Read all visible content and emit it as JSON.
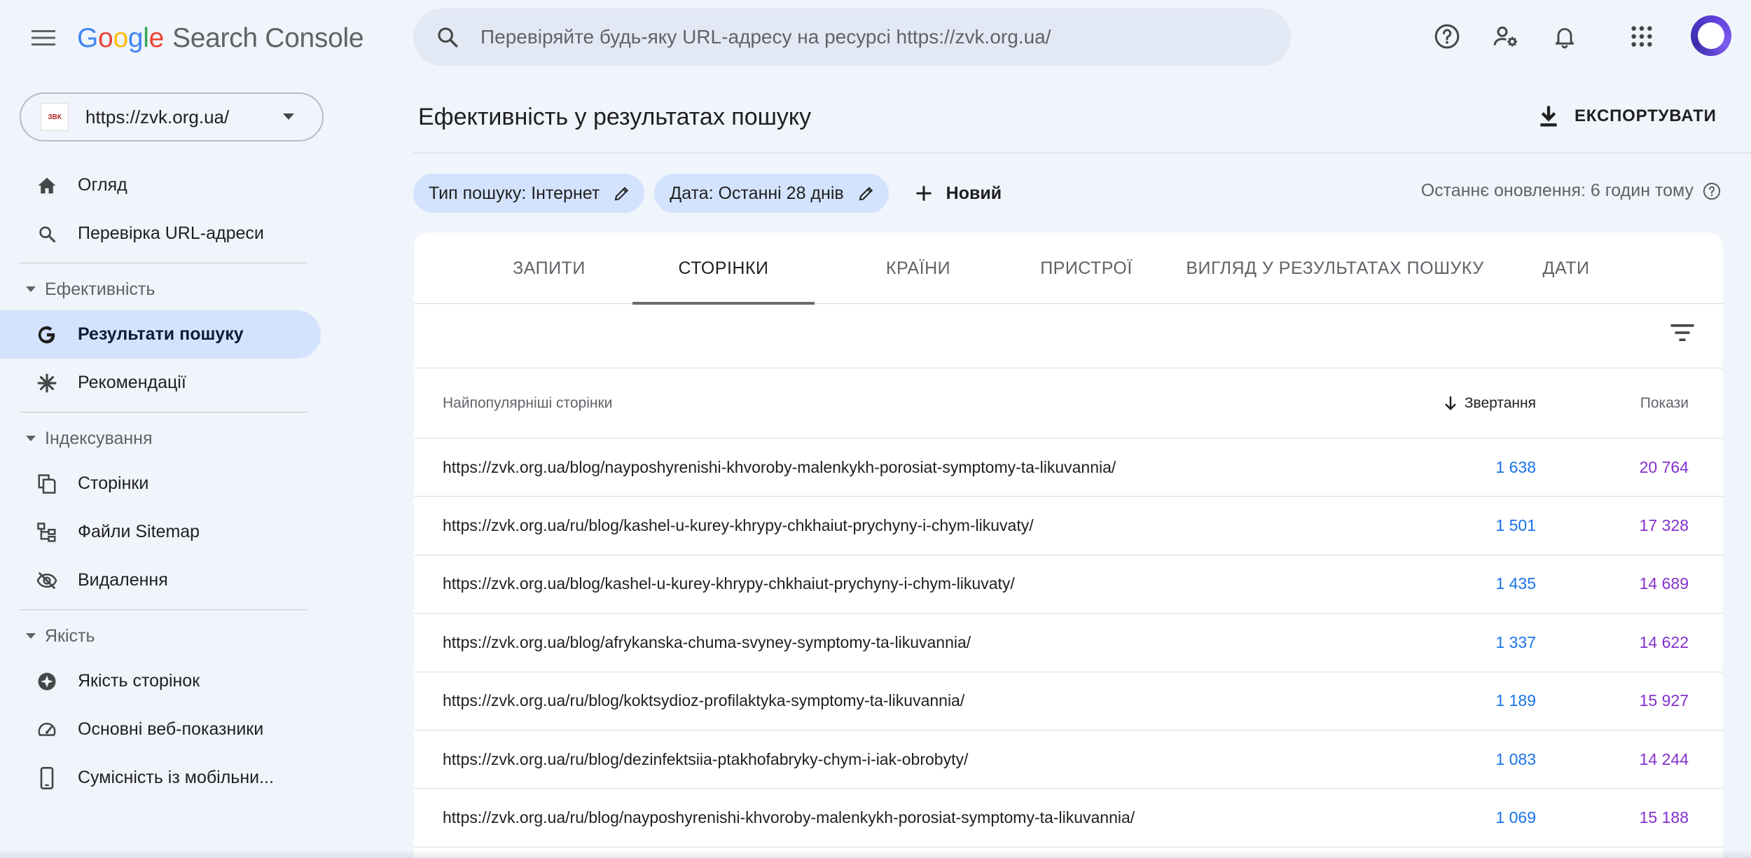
{
  "app": {
    "logo_letters": [
      "G",
      "o",
      "o",
      "g",
      "l",
      "e"
    ],
    "product": "Search Console"
  },
  "search": {
    "placeholder": "Перевіряйте будь-яку URL-адресу на ресурсі https://zvk.org.ua/"
  },
  "top_actions": [
    "help-icon",
    "manage-users-icon",
    "notifications-icon",
    "apps-grid-icon"
  ],
  "property": {
    "favicon_text": "ЗВК",
    "url": "https://zvk.org.ua/"
  },
  "sidebar": {
    "overview": "Огляд",
    "url_inspection": "Перевірка URL-адреси",
    "performance_section": "Ефективність",
    "search_results": "Результати пошуку",
    "recommendations": "Рекомендації",
    "indexing_section": "Індексування",
    "pages": "Сторінки",
    "sitemaps": "Файли Sitemap",
    "removals": "Видалення",
    "quality_section": "Якість",
    "page_experience": "Якість сторінок",
    "core_web_vitals": "Основні веб-показники",
    "mobile_usability": "Сумісність із мобільни..."
  },
  "main": {
    "title": "Ефективність у результатах пошуку",
    "export_label": "ЕКСПОРТУВАТИ",
    "chip_search_type": "Тип пошуку: Інтернет",
    "chip_date": "Дата: Останні 28 днів",
    "new_label": "Новий",
    "last_update": "Останнє оновлення: 6 годин тому"
  },
  "tabs": {
    "queries": "ЗАПИТИ",
    "pages": "СТОРІНКИ",
    "countries": "КРАЇНИ",
    "devices": "ПРИСТРОЇ",
    "search_appearance": "ВИГЛЯД У РЕЗУЛЬТАТАХ ПОШУКУ",
    "dates": "ДАТИ",
    "active": "pages"
  },
  "table": {
    "col_page": "Найпопулярніші сторінки",
    "col_clicks": "Звертання",
    "col_impressions": "Покази",
    "rows": [
      {
        "url": "https://zvk.org.ua/blog/nayposhyrenishi-khvoroby-malenkykh-porosiat-symptomy-ta-likuvannia/",
        "clicks": "1 638",
        "impressions": "20 764"
      },
      {
        "url": "https://zvk.org.ua/ru/blog/kashel-u-kurey-khrypy-chkhaiut-prychyny-i-chym-likuvaty/",
        "clicks": "1 501",
        "impressions": "17 328"
      },
      {
        "url": "https://zvk.org.ua/blog/kashel-u-kurey-khrypy-chkhaiut-prychyny-i-chym-likuvaty/",
        "clicks": "1 435",
        "impressions": "14 689"
      },
      {
        "url": "https://zvk.org.ua/blog/afrykanska-chuma-svyney-symptomy-ta-likuvannia/",
        "clicks": "1 337",
        "impressions": "14 622"
      },
      {
        "url": "https://zvk.org.ua/ru/blog/koktsydioz-profilaktyka-symptomy-ta-likuvannia/",
        "clicks": "1 189",
        "impressions": "15 927"
      },
      {
        "url": "https://zvk.org.ua/ru/blog/dezinfektsiia-ptakhofabryky-chym-i-iak-obrobyty/",
        "clicks": "1 083",
        "impressions": "14 244"
      },
      {
        "url": "https://zvk.org.ua/ru/blog/nayposhyrenishi-khvoroby-malenkykh-porosiat-symptomy-ta-likuvannia/",
        "clicks": "1 069",
        "impressions": "15 188"
      }
    ]
  },
  "colors": {
    "accent_active": "#d3e3fd",
    "clicks_blue": "#1a73e8",
    "impressions_purple": "#8430ce",
    "background": "#f0f4fb"
  }
}
